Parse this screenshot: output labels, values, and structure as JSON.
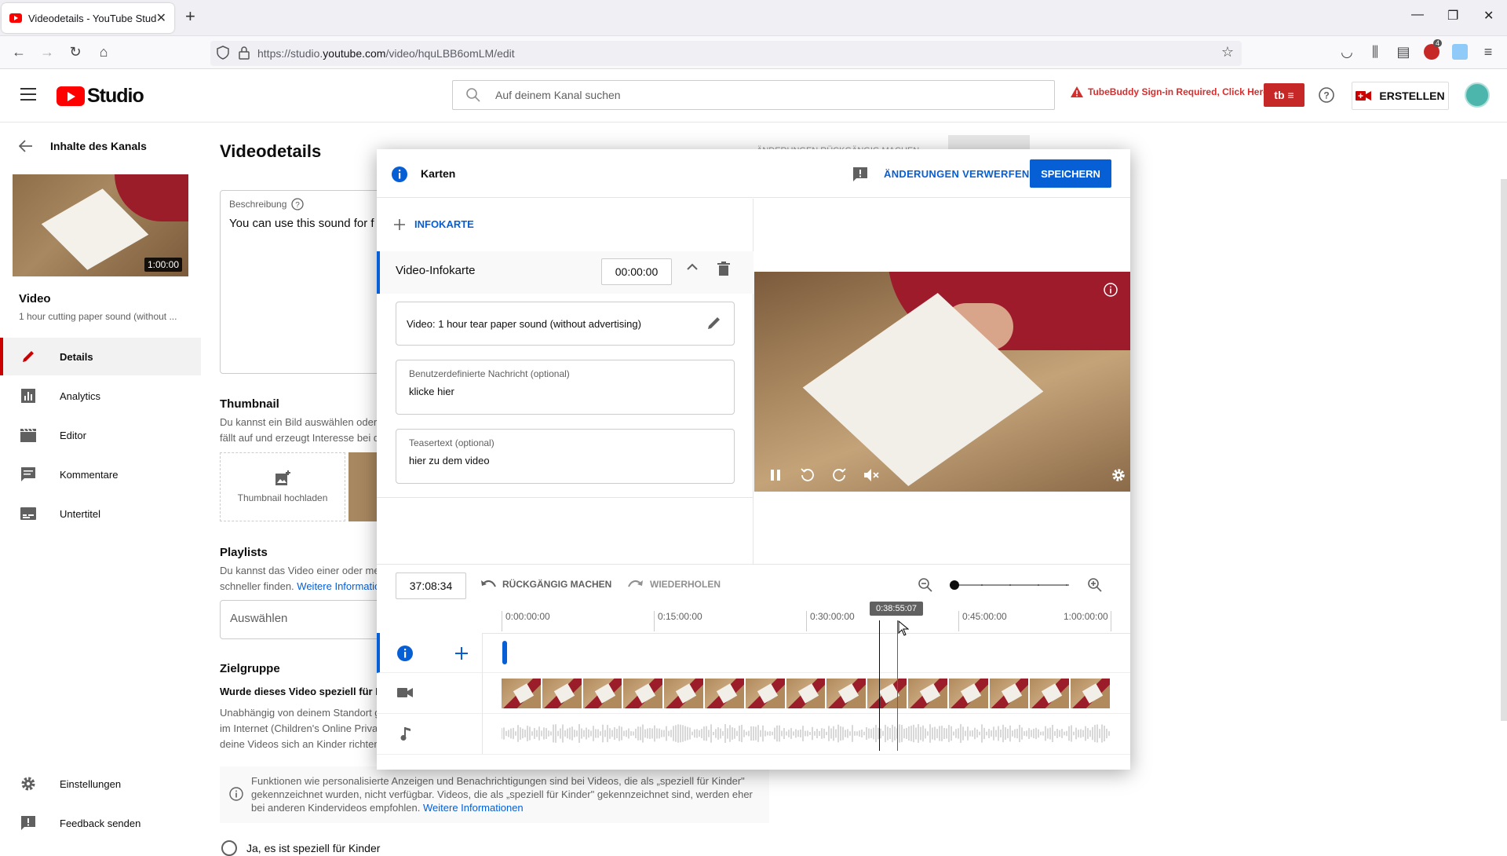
{
  "browser": {
    "tab_title": "Videodetails - YouTube Studio",
    "url_prefix": "https://studio.",
    "url_domain": "youtube.com",
    "url_path": "/video/hquLBB6omLM/edit",
    "ext_badge": "4"
  },
  "header": {
    "brand": "Studio",
    "search_placeholder": "Auf deinem Kanal suchen",
    "tubebuddy": "TubeBuddy Sign-in Required, Click Here",
    "tb_label": "tb",
    "create_label": "ERSTELLEN"
  },
  "sidebar": {
    "back_label": "Inhalte des Kanals",
    "thumb_duration": "1:00:00",
    "video_label": "Video",
    "video_title": "1 hour cutting paper sound (without ...",
    "items": [
      {
        "label": "Details",
        "icon": "pencil-icon",
        "active": true
      },
      {
        "label": "Analytics",
        "icon": "analytics-icon"
      },
      {
        "label": "Editor",
        "icon": "clapperboard-icon"
      },
      {
        "label": "Kommentare",
        "icon": "comment-icon"
      },
      {
        "label": "Untertitel",
        "icon": "subtitles-icon"
      }
    ],
    "bottom": [
      {
        "label": "Einstellungen",
        "icon": "gear-icon"
      },
      {
        "label": "Feedback senden",
        "icon": "feedback-icon"
      }
    ]
  },
  "main": {
    "title": "Videodetails",
    "top_action": "ÄNDERUNGEN RÜCKGÄNGIG MACHEN",
    "desc_label": "Beschreibung",
    "desc_text": "You can use this sound for f",
    "thumbnail_title": "Thumbnail",
    "thumbnail_text_1": "Du kannst ein Bild auswählen oder",
    "thumbnail_text_2": "fällt auf und erzeugt Interesse bei d",
    "thumbnail_upload": "Thumbnail hochladen",
    "playlists_title": "Playlists",
    "playlists_text_1": "Du kannst das Video einer oder me",
    "playlists_text_2": "schneller finden.",
    "playlists_link": "Weitere Informatio",
    "select_label": "Auswählen",
    "audience_title": "Zielgruppe",
    "audience_q": "Wurde dieses Video speziell für Ki",
    "audience_text_1": "Unabhängig von deinem Standort g",
    "audience_text_2": "im Internet (Children's Online Privac",
    "audience_text_3": "deine Videos sich an Kinder richten",
    "info_text": "Funktionen wie personalisierte Anzeigen und Benachrichtigungen sind bei Videos, die als „speziell für Kinder\" gekennzeichnet wurden, nicht verfügbar. Videos, die als „speziell für Kinder\" gekennzeichnet sind, werden eher bei anderen Kindervideos empfohlen.",
    "info_link": "Weitere Informationen",
    "radio_label": "Ja, es ist speziell für Kinder"
  },
  "modal": {
    "title": "Karten",
    "discard": "ÄNDERUNGEN VERWERFEN",
    "save": "SPEICHERN",
    "add_card": "INFOKARTE",
    "card_name": "Video-Infokarte",
    "card_time": "00:00:00",
    "video_field": "Video: 1 hour tear paper sound (without advertising)",
    "msg_label": "Benutzerdefinierte Nachricht (optional)",
    "msg_value": "klicke hier",
    "teaser_label": "Teasertext (optional)",
    "teaser_value": "hier zu dem video"
  },
  "timeline": {
    "current_time": "37:08:34",
    "undo": "RÜCKGÄNGIG MACHEN",
    "redo": "WIEDERHOLEN",
    "ticks": [
      "0:00:00:00",
      "0:15:00:00",
      "0:30:00:00",
      "0:45:00:00",
      "1:00:00:00"
    ],
    "hover_time": "0:38:55:07",
    "zoom_level": 0
  },
  "colors": {
    "accent": "#065fd4",
    "brand_red": "#ff0000",
    "active_red": "#cc0000"
  }
}
